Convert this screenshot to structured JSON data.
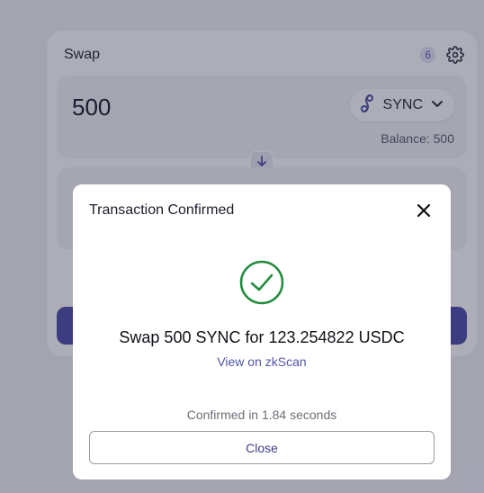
{
  "swap_card": {
    "title": "Swap",
    "badge": "6",
    "input_amount": "500",
    "token_symbol": "SYNC",
    "balance": "Balance: 500"
  },
  "modal": {
    "title": "Transaction Confirmed",
    "message": "Swap 500 SYNC for 123.254822 USDC",
    "link_label": "View on zkScan",
    "confirmed_text": "Confirmed in 1.84 seconds",
    "close_label": "Close"
  },
  "colors": {
    "accent": "#4f4fa8",
    "success": "#1f8b3c",
    "overlay": "#1c1c3a"
  },
  "icons": {
    "gear": "gear-icon",
    "token": "sync-token-icon",
    "chevron": "chevron-down-icon",
    "arrow": "arrow-down-icon",
    "close": "close-icon",
    "check": "check-circle-icon"
  }
}
